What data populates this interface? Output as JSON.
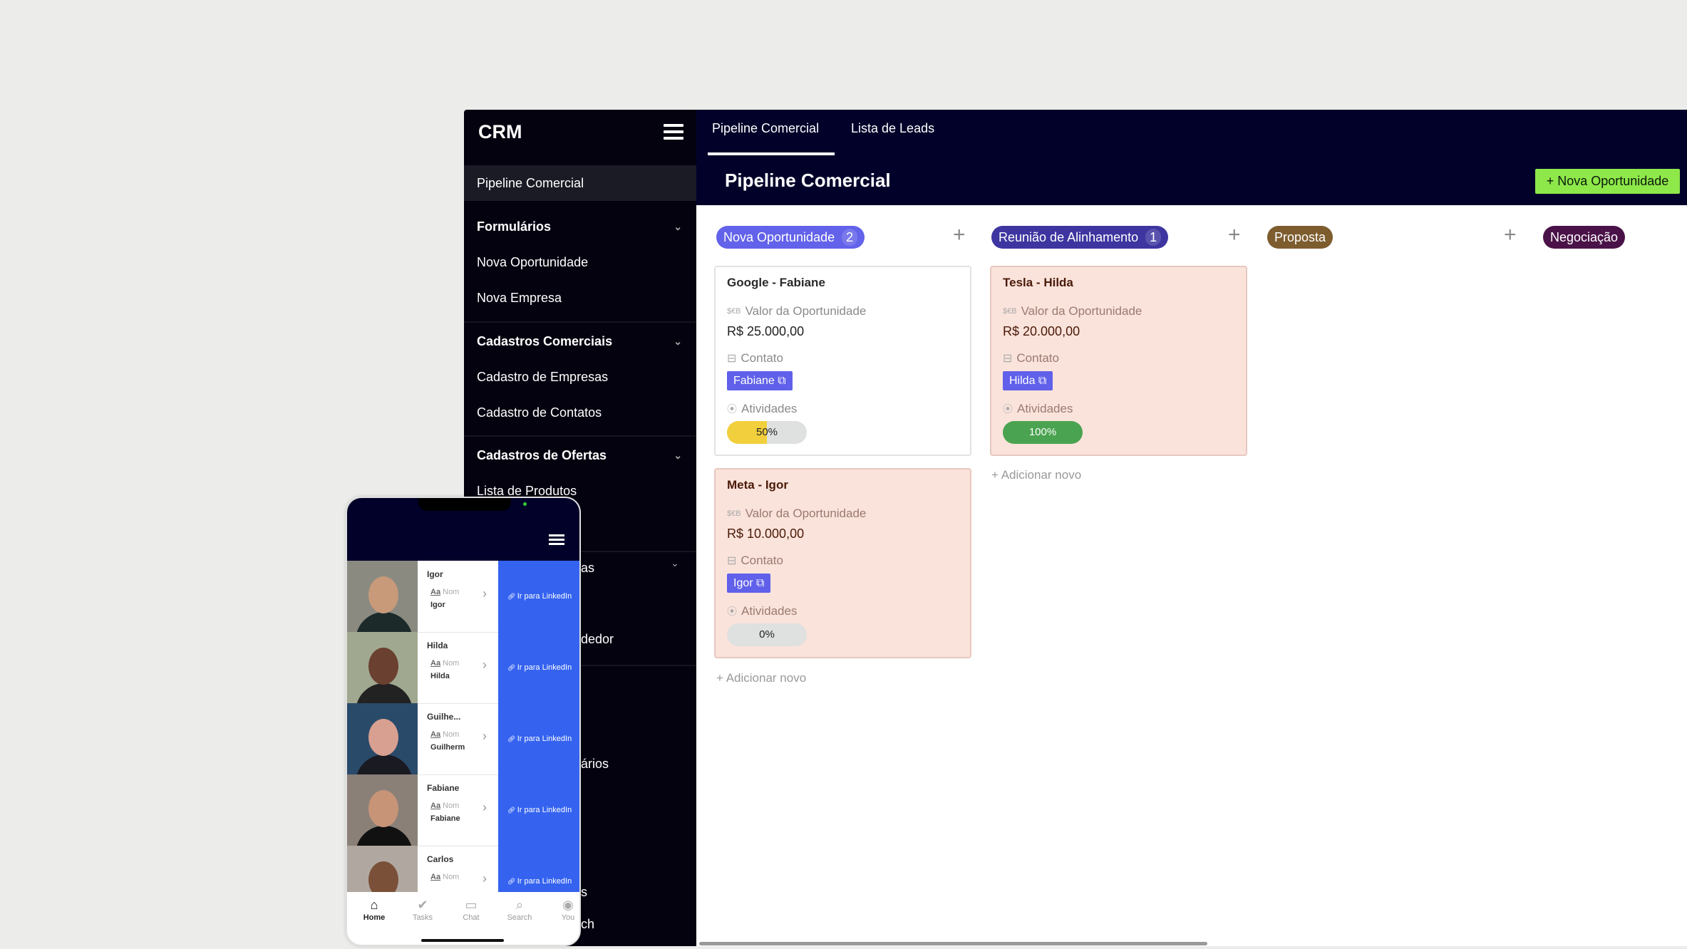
{
  "app": {
    "title": "CRM"
  },
  "sidebar": {
    "items": [
      {
        "label": "Pipeline Comercial",
        "active": true
      },
      {
        "label": "Formulários",
        "group": true
      },
      {
        "label": "Nova Oportunidade"
      },
      {
        "label": "Nova Empresa"
      },
      {
        "label": "Cadastros Comerciais",
        "group": true
      },
      {
        "label": "Cadastro de Empresas"
      },
      {
        "label": "Cadastro de Contatos"
      },
      {
        "label": "Cadastros de Ofertas",
        "group": true
      },
      {
        "label": "Lista de Produtos"
      }
    ],
    "partial_items": [
      "as",
      "dedor",
      "ários",
      "s",
      "ch"
    ]
  },
  "tabs": [
    {
      "label": "Pipeline Comercial",
      "active": true
    },
    {
      "label": "Lista de Leads"
    }
  ],
  "header": {
    "title": "Pipeline Comercial",
    "new_button": "+ Nova Oportunidade",
    "new_button_color": "#8ee84a"
  },
  "columns": [
    {
      "name": "Nova Oportunidade",
      "count": "2",
      "color": "#6262ea"
    },
    {
      "name": "Reunião de Alinhamento",
      "count": "1",
      "color": "#3e35a0"
    },
    {
      "name": "Proposta",
      "color": "#7d5c2e"
    },
    {
      "name": "Negociação",
      "color": "#4a1248"
    }
  ],
  "labels": {
    "valor": "Valor da Oportunidade",
    "contato": "Contato",
    "atividades": "Atividades",
    "add_new": "+ Adicionar novo",
    "currency_icon": "$€B"
  },
  "cards": [
    {
      "title": "Google - Fabiane",
      "value": "R$ 25.000,00",
      "contact": "Fabiane",
      "progress": 50,
      "progress_label": "50%",
      "progress_color": "#f2cf3c"
    },
    {
      "title": "Meta - Igor",
      "value": "R$ 10.000,00",
      "contact": "Igor",
      "progress": 0,
      "progress_label": "0%",
      "progress_color": "#dfe0e0"
    },
    {
      "title": "Tesla - Hilda",
      "value": "R$ 20.000,00",
      "contact": "Hilda",
      "progress": 100,
      "progress_label": "100%",
      "progress_color": "#4aa350"
    }
  ],
  "phone": {
    "field_label": "Nom",
    "field_icon": "Aa",
    "link_label": "Ir para LinkedIn",
    "contacts": [
      {
        "name": "Igor",
        "value": "Igor"
      },
      {
        "name": "Hilda",
        "value": "Hilda"
      },
      {
        "name": "Guilhe...",
        "value": "Guilherm"
      },
      {
        "name": "Fabiane",
        "value": "Fabiane"
      },
      {
        "name": "Carlos",
        "value": ""
      }
    ],
    "nav": [
      {
        "label": "Home",
        "icon": "home-icon",
        "active": true
      },
      {
        "label": "Tasks",
        "icon": "check-circle-icon"
      },
      {
        "label": "Chat",
        "icon": "chat-icon"
      },
      {
        "label": "Search",
        "icon": "search-icon"
      },
      {
        "label": "You",
        "icon": "user-icon"
      }
    ]
  }
}
